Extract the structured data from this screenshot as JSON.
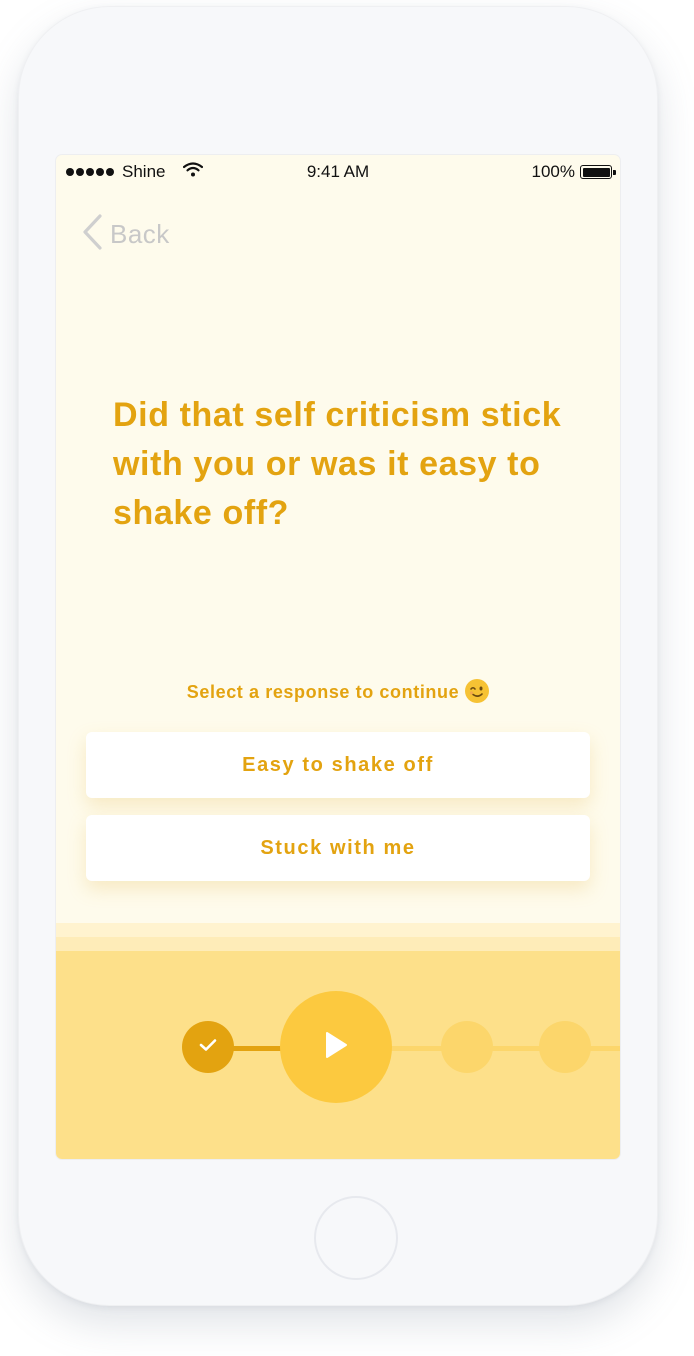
{
  "status_bar": {
    "carrier": "Shine",
    "time": "9:41 AM",
    "battery": "100%"
  },
  "nav": {
    "back_label": "Back"
  },
  "question": "Did that self criticism stick with you or was it easy to shake off?",
  "prompt": "Select a response to continue",
  "prompt_emoji": "winking-face-icon",
  "options": [
    {
      "label": "Easy to shake off"
    },
    {
      "label": "Stuck with me"
    }
  ],
  "progress": {
    "steps_total": 4,
    "steps_completed": 1,
    "current_step": 2
  },
  "colors": {
    "accent": "#e3a310",
    "background": "#fefbec",
    "bottom_panel": "#fde08a",
    "play_button": "#fcc93f"
  }
}
